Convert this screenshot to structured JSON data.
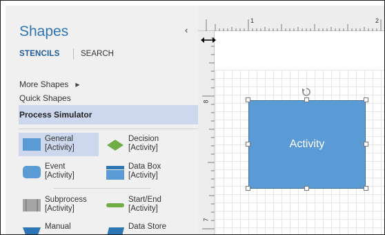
{
  "shapes_pane": {
    "title": "Shapes",
    "collapse_glyph": "‹",
    "tabs": {
      "stencils": "STENCILS",
      "search": "SEARCH"
    },
    "menu": {
      "more_shapes": "More Shapes",
      "more_arrow": "▶",
      "quick_shapes": "Quick Shapes",
      "process_simulator": "Process Simulator"
    },
    "items": [
      {
        "line1": "General",
        "line2": "[Activity]",
        "icon": "general-activity-icon",
        "selected": true
      },
      {
        "line1": "Decision",
        "line2": "[Activity]",
        "icon": "decision-activity-icon"
      },
      {
        "line1": "Event",
        "line2": "[Activity]",
        "icon": "event-activity-icon"
      },
      {
        "line1": "Data Box",
        "line2": "[Activity]",
        "icon": "data-box-activity-icon"
      },
      {
        "line1": "Subprocess",
        "line2": "[Activity]",
        "icon": "subprocess-activity-icon"
      },
      {
        "line1": "Start/End",
        "line2": "[Activity]",
        "icon": "start-end-activity-icon"
      },
      {
        "line1": "Manual",
        "line2": "",
        "icon": "manual-icon"
      },
      {
        "line1": "Data Store",
        "line2": "",
        "icon": "data-store-icon"
      }
    ]
  },
  "canvas": {
    "ruler_top_labels": [
      "1",
      "2"
    ],
    "ruler_left_labels": [
      "8",
      "7"
    ],
    "activity_label": "Activity"
  },
  "colors": {
    "accent": "#2e75b6",
    "selection": "#cdd8ee",
    "activity_fill": "#5b9bd5",
    "green": "#70ad47",
    "gray": "#a5a5a5"
  }
}
